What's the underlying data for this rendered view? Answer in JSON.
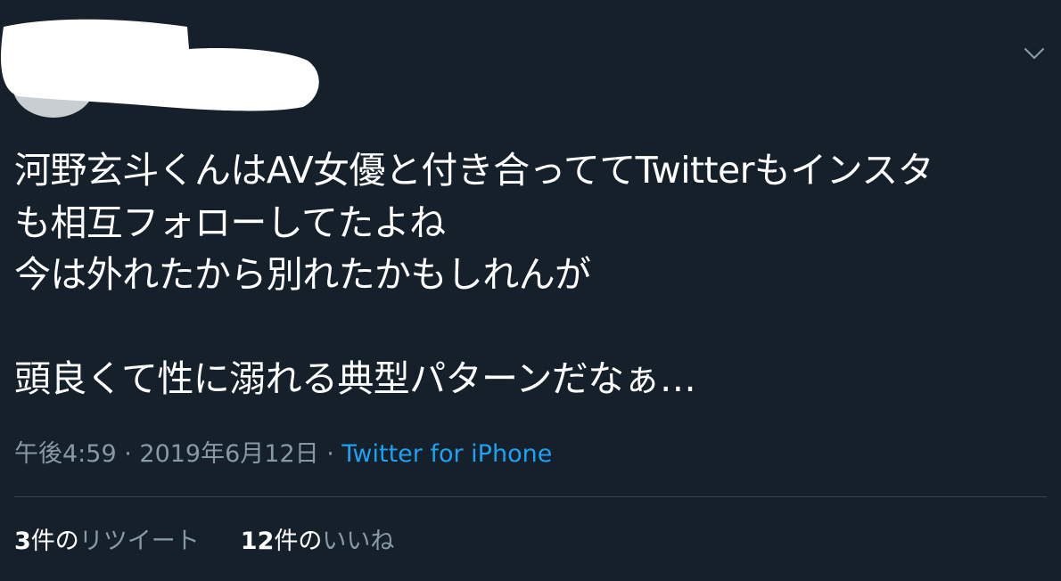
{
  "tweet": {
    "text": "河野玄斗くんはAV女優と付き合っててTwitterもインスタ\nも相互フォローしてたよね\n今は外れたから別れたかもしれんが\n\n頭良くて性に溺れる典型パターンだなぁ…",
    "time": "午後4:59",
    "separator": " · ",
    "date": "2019年6月12日",
    "source": "Twitter for iPhone"
  },
  "stats": {
    "retweets": {
      "count": "3",
      "unit": "件の",
      "label": "リツイート"
    },
    "likes": {
      "count": "12",
      "unit": "件の",
      "label": "いいね"
    }
  },
  "colors": {
    "background": "#15202b",
    "text": "#ffffff",
    "secondary": "#8899a6",
    "accent": "#1da1f2",
    "divider": "#38444d"
  },
  "icons": {
    "menu": "chevron-down-icon"
  }
}
